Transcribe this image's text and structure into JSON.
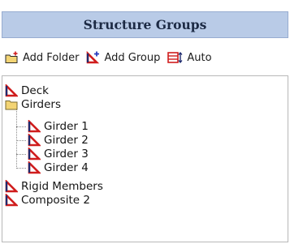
{
  "header": {
    "title": "Structure Groups"
  },
  "toolbar": {
    "add_folder_label": "Add Folder",
    "add_group_label": "Add Group",
    "auto_label": "Auto"
  },
  "tree": {
    "items": [
      {
        "label": "Deck",
        "icon": "structure-group-icon"
      },
      {
        "label": "Girders",
        "icon": "folder-icon"
      },
      {
        "label": "Girder 1",
        "icon": "structure-group-icon"
      },
      {
        "label": "Girder 2",
        "icon": "structure-group-icon"
      },
      {
        "label": "Girder 3",
        "icon": "structure-group-icon"
      },
      {
        "label": "Girder 4",
        "icon": "structure-group-icon"
      },
      {
        "label": "Rigid Members",
        "icon": "structure-group-icon"
      },
      {
        "label": "Composite 2",
        "icon": "structure-group-icon"
      }
    ]
  },
  "colors": {
    "header_bg": "#b9cbe7",
    "icon_red": "#d01d1d",
    "icon_navy": "#1e2a6e",
    "folder_yellow": "#f3d474"
  }
}
